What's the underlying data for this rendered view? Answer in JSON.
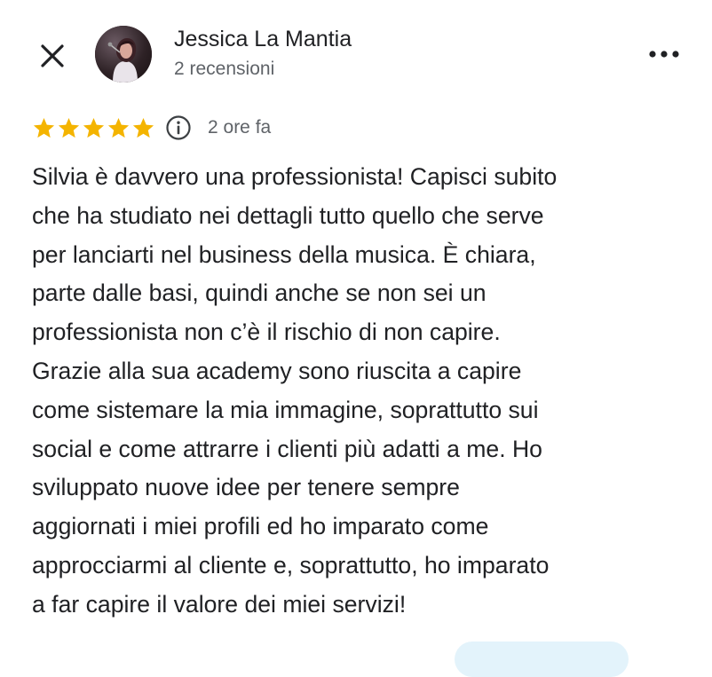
{
  "reviewer": {
    "name": "Jessica La Mantia",
    "review_count": "2 recensioni"
  },
  "review": {
    "rating": 5,
    "rating_max": 5,
    "star_color": "#f4b400",
    "time": "2 ore fa",
    "text_lines": [
      "Silvia è davvero una professionista! Capisci subito",
      "che ha studiato nei dettagli tutto quello che serve",
      "per lanciarti nel business della musica. È chiara,",
      "parte dalle basi, quindi anche se non sei un",
      "professionista non c’è il rischio di non capire.",
      "Grazie alla sua academy sono riuscita a capire",
      "come sistemare la mia immagine, soprattutto sui",
      "social e come attrarre i clienti più adatti a me. Ho",
      "sviluppato nuove idee per tenere sempre",
      "aggiornati i miei profili ed ho imparato come",
      "approcciarmi al cliente e, soprattutto, ho imparato",
      "a far capire il valore dei miei servizi!"
    ]
  },
  "icons": {
    "close": "close-icon",
    "more": "more-horizontal-icon",
    "info": "info-icon",
    "star": "star-icon"
  },
  "colors": {
    "text_primary": "#202124",
    "text_secondary": "#5f6368",
    "chip_background": "#e3f3fb"
  }
}
